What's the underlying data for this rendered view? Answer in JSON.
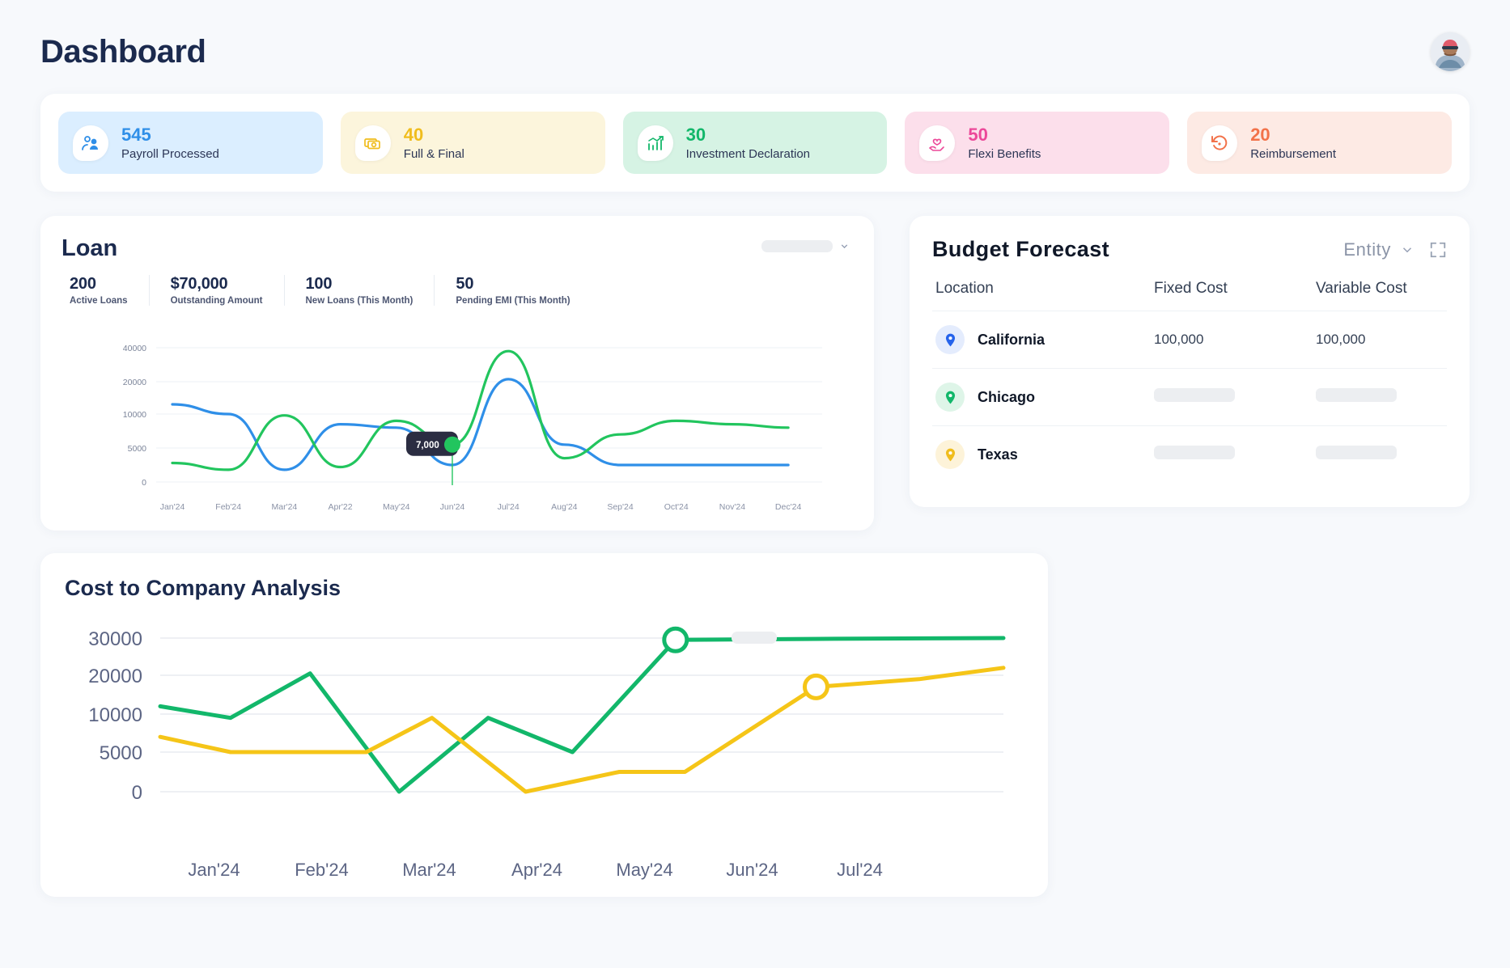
{
  "header": {
    "title": "Dashboard",
    "avatar_name": "user-avatar"
  },
  "stats": [
    {
      "value": "545",
      "label": "Payroll Processed",
      "icon": "users-icon",
      "bg": "#dbeeff",
      "color": "#2f8fe8"
    },
    {
      "value": "40",
      "label": "Full & Final",
      "icon": "cash-icon",
      "bg": "#fcf5dc",
      "color": "#f0bd1d"
    },
    {
      "value": "30",
      "label": "Investment Declaration",
      "icon": "chart-bar-icon",
      "bg": "#d6f3e4",
      "color": "#12b76a"
    },
    {
      "value": "50",
      "label": "Flexi Benefits",
      "icon": "hand-heart-icon",
      "bg": "#fcdfeb",
      "color": "#ec4899"
    },
    {
      "value": "20",
      "label": "Reimbursement",
      "icon": "refund-icon",
      "bg": "#fdeae4",
      "color": "#f2724a"
    }
  ],
  "loan": {
    "title": "Loan",
    "dropdown_placeholder": "",
    "stats": [
      {
        "value": "200",
        "label": "Active Loans"
      },
      {
        "value": "$70,000",
        "label": "Outstanding Amount"
      },
      {
        "value": "100",
        "label": "New Loans (This Month)"
      },
      {
        "value": "50",
        "label": "Pending EMI (This Month)"
      }
    ],
    "tooltip_value": "7,000"
  },
  "budget": {
    "title": "Budget  Forecast",
    "entity_label": "Entity",
    "columns": [
      "Location",
      "Fixed Cost",
      "Variable Cost"
    ],
    "rows": [
      {
        "location": "California",
        "pin_color": "#2563eb",
        "pin_bg": "#e4ecfd",
        "fixed": "100,000",
        "variable": "100,000",
        "loading": false
      },
      {
        "location": "Chicago",
        "pin_color": "#12b76a",
        "pin_bg": "#def5e8",
        "fixed": "",
        "variable": "",
        "loading": true
      },
      {
        "location": "Texas",
        "pin_color": "#f0bd1d",
        "pin_bg": "#fdf3d9",
        "fixed": "",
        "variable": "",
        "loading": true
      }
    ]
  },
  "ctc": {
    "title": "Cost to Company Analysis"
  },
  "chart_data": [
    {
      "type": "line",
      "id": "loan-chart",
      "title": "Loan",
      "xlabel": "",
      "ylabel": "",
      "grid": true,
      "legend": "none",
      "yticks": [
        0,
        5000,
        10000,
        20000,
        40000
      ],
      "ylim": [
        0,
        45000
      ],
      "categories": [
        "Jan'24",
        "Feb'24",
        "Mar'24",
        "Apr'22",
        "May'24",
        "Jun'24",
        "Jul'24",
        "Aug'24",
        "Sep'24",
        "Oct'24",
        "Nov'24",
        "Dec'24"
      ],
      "series": [
        {
          "name": "series-blue",
          "color": "#2f8fe8",
          "values": [
            13000,
            10000,
            1800,
            8500,
            8000,
            2500,
            21500,
            5500,
            2500,
            2500,
            2500,
            2500
          ]
        },
        {
          "name": "series-green",
          "color": "#22c55e",
          "values": [
            2800,
            1800,
            9800,
            2200,
            9000,
            5500,
            38000,
            3500,
            7000,
            9000,
            8500,
            8000
          ]
        }
      ],
      "annotations": [
        {
          "label": "7,000",
          "series": "series-green",
          "x": "Jun'24"
        }
      ]
    },
    {
      "type": "line",
      "id": "cost-to-company-chart",
      "title": "Cost to Company Analysis",
      "xlabel": "",
      "ylabel": "",
      "grid": true,
      "legend": "none",
      "yticks": [
        0,
        5000,
        10000,
        20000,
        30000
      ],
      "ylim": [
        0,
        33000
      ],
      "categories": [
        "Jan'24",
        "Feb'24",
        "Mar'24",
        "Apr'24",
        "May'24",
        "Jun'24",
        "Jul'24"
      ],
      "series": [
        {
          "name": "series-green",
          "color": "#12b76a",
          "values": [
            12000,
            9500,
            20500,
            0,
            9500,
            5000,
            29500,
            29800,
            31500
          ],
          "markers": [
            {
              "x": "May'24",
              "y": 29500
            }
          ]
        },
        {
          "name": "series-yellow",
          "color": "#f5c518",
          "values": [
            7000,
            5000,
            5000,
            9500,
            0,
            2500,
            2500,
            17000,
            19000,
            22000
          ],
          "markers": [
            {
              "x": "Jun'24",
              "y": 17000
            }
          ]
        }
      ]
    }
  ]
}
